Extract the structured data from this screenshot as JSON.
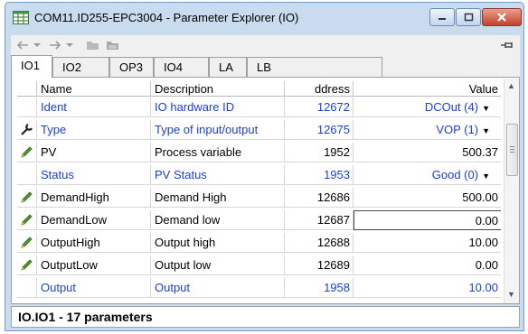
{
  "window": {
    "title": "COM11.ID255-EPC3004 - Parameter Explorer (IO)"
  },
  "toolbar": {
    "icons": [
      "back-icon",
      "back-dropdown-icon",
      "forward-icon",
      "forward-dropdown-icon",
      "folder-icon",
      "folder-up-icon",
      "pin-icon"
    ]
  },
  "tabs": [
    {
      "label": "IO1",
      "active": true
    },
    {
      "label": "IO2",
      "active": false
    },
    {
      "label": "OP3",
      "active": false
    },
    {
      "label": "IO4",
      "active": false
    },
    {
      "label": "LA",
      "active": false
    },
    {
      "label": "LB",
      "active": false
    }
  ],
  "table": {
    "columns": [
      "Name",
      "Description",
      "ddress",
      "Value"
    ],
    "rows": [
      {
        "icon": "",
        "name": "Ident",
        "description": "IO hardware ID",
        "address": "12672",
        "value": "DCOut (4)",
        "dropdown": true,
        "blue": true
      },
      {
        "icon": "wrench-icon",
        "name": "Type",
        "description": "Type of input/output",
        "address": "12675",
        "value": "VOP (1)",
        "dropdown": true,
        "blue": true
      },
      {
        "icon": "pencil-icon",
        "name": "PV",
        "description": "Process variable",
        "address": "1952",
        "value": "500.37",
        "dropdown": false,
        "blue": false
      },
      {
        "icon": "",
        "name": "Status",
        "description": "PV Status",
        "address": "1953",
        "value": "Good (0)",
        "dropdown": true,
        "blue": true
      },
      {
        "icon": "pencil-icon",
        "name": "DemandHigh",
        "description": "Demand High",
        "address": "12686",
        "value": "500.00",
        "dropdown": false,
        "blue": false
      },
      {
        "icon": "pencil-icon",
        "name": "DemandLow",
        "description": "Demand low",
        "address": "12687",
        "value": "0.00",
        "dropdown": false,
        "blue": false,
        "editing": true
      },
      {
        "icon": "pencil-icon",
        "name": "OutputHigh",
        "description": "Output high",
        "address": "12688",
        "value": "10.00",
        "dropdown": false,
        "blue": false
      },
      {
        "icon": "pencil-icon",
        "name": "OutputLow",
        "description": "Output low",
        "address": "12689",
        "value": "0.00",
        "dropdown": false,
        "blue": false
      },
      {
        "icon": "",
        "name": "Output",
        "description": "Output",
        "address": "1958",
        "value": "10.00",
        "dropdown": false,
        "blue": true
      }
    ]
  },
  "status": {
    "text": "IO.IO1  -  17 parameters"
  },
  "colors": {
    "accent_blue": "#1a3fd6",
    "pencil_green": "#4f9a2a",
    "titlebar": "#c9dcef"
  }
}
